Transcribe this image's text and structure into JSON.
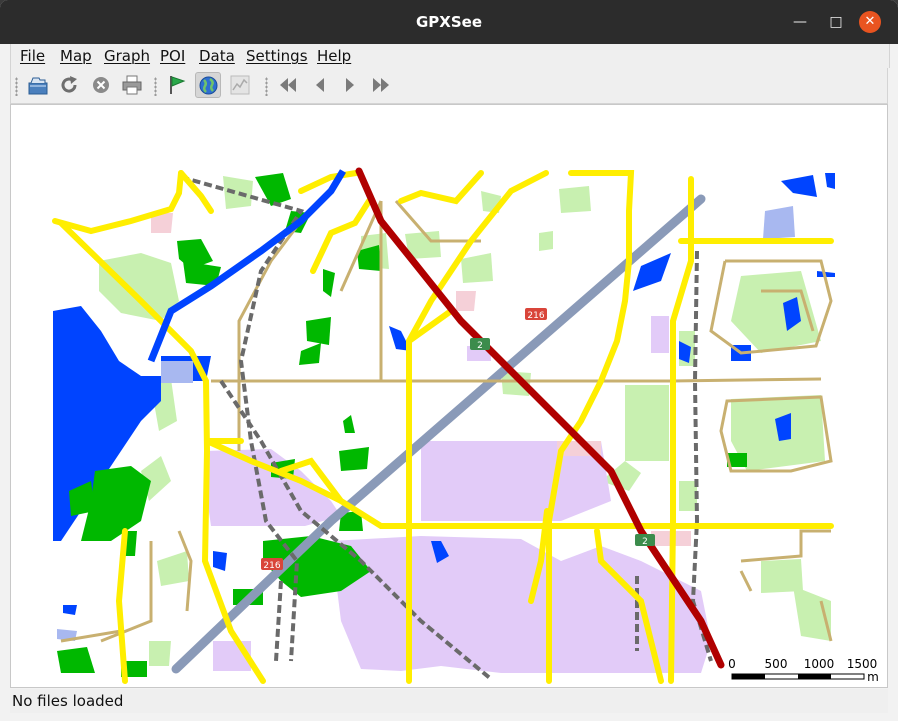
{
  "window": {
    "title": "GPXSee"
  },
  "menubar": {
    "items": [
      "File",
      "Map",
      "Graph",
      "POI",
      "Data",
      "Settings",
      "Help"
    ]
  },
  "toolbar": {
    "buttons": [
      {
        "icon": "open-file-icon"
      },
      {
        "icon": "reload-icon"
      },
      {
        "icon": "close-file-icon"
      },
      {
        "icon": "print-icon"
      },
      {
        "icon": "poi-flag-icon"
      },
      {
        "icon": "show-map-icon",
        "active": true
      },
      {
        "icon": "show-graphs-icon",
        "disabled": true
      },
      {
        "icon": "first-file-icon"
      },
      {
        "icon": "previous-file-icon"
      },
      {
        "icon": "next-file-icon"
      },
      {
        "icon": "last-file-icon"
      }
    ]
  },
  "map": {
    "route_shields": [
      "216",
      "2",
      "2",
      "216"
    ],
    "scale": {
      "labels": [
        "0",
        "500",
        "1000",
        "1500"
      ],
      "unit": "m"
    },
    "colors": {
      "major_road": "#ffee00",
      "motorway": "#b00000",
      "trunk": "#8a9ab8",
      "water": "#0044ff",
      "forest": "#00b800",
      "park": "#c8f0b0",
      "landuse": "#e0c8f8",
      "railway": "#666666"
    }
  },
  "statusbar": {
    "text": "No files loaded"
  }
}
